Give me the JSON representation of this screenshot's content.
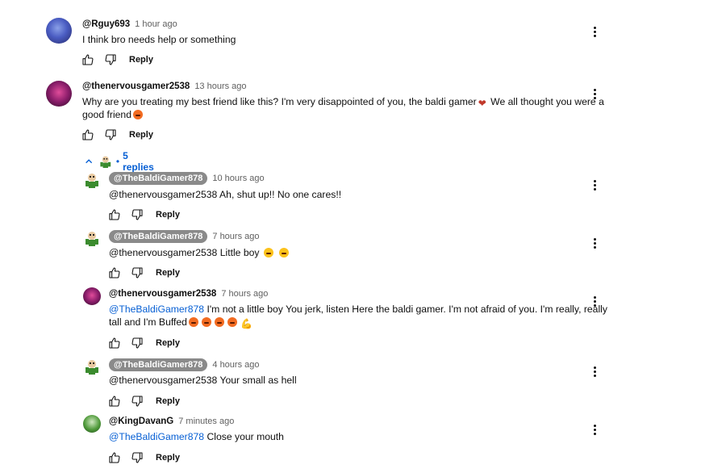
{
  "comments": [
    {
      "author": "@Rguy693",
      "time": "1 hour ago",
      "text": "I think bro needs help or something",
      "reply": "Reply"
    },
    {
      "author": "@thenervousgamer2538",
      "time": "13 hours ago",
      "text_line1": "Why are you treating my best friend like this? I'm very disappointed of you, the baldi gamer",
      "text_line1_tail": " We all thought you were a",
      "text_line2": "good friend",
      "reply": "Reply"
    }
  ],
  "replies_toggle": {
    "label": "5 replies",
    "separator": "•"
  },
  "replies": [
    {
      "author": "@TheBaldiGamer878",
      "time": "10 hours ago",
      "text": "@thenervousgamer2538 Ah, shut up!! No one cares!!",
      "reply": "Reply"
    },
    {
      "author": "@TheBaldiGamer878",
      "time": "7 hours ago",
      "text": "@thenervousgamer2538 Little boy",
      "reply": "Reply"
    },
    {
      "author": "@thenervousgamer2538",
      "time": "7 hours ago",
      "mention": "@TheBaldiGamer878",
      "text_line1": "  I'm not a little boy You jerk, listen Here the baldi gamer. I'm not afraid of you. I'm really, really",
      "text_line2": "tall and I'm Buffed",
      "reply": "Reply"
    },
    {
      "author": "@TheBaldiGamer878",
      "time": "4 hours ago",
      "text": "@thenervousgamer2538 Your small as hell",
      "reply": "Reply"
    },
    {
      "author": "@KingDavanG",
      "time": "7 minutes ago",
      "mention": "@TheBaldiGamer878",
      "text": "  Close your mouth",
      "reply": "Reply"
    }
  ],
  "colors": {
    "link": "#065fd4",
    "badge": "#8a8a8a",
    "meta": "#606060"
  },
  "icons": [
    "like-icon",
    "dislike-icon",
    "more-vert-icon",
    "chevron-up-icon"
  ]
}
